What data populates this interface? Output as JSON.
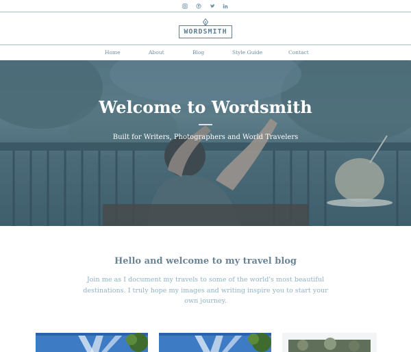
{
  "social": {
    "icons": [
      "instagram-icon",
      "pinterest-icon",
      "twitter-icon",
      "linkedin-icon"
    ]
  },
  "site": {
    "logo_text": "WORDSMITH"
  },
  "nav": {
    "items": [
      {
        "label": "Home"
      },
      {
        "label": "About"
      },
      {
        "label": "Blog"
      },
      {
        "label": "Style Guide"
      },
      {
        "label": "Contact"
      }
    ]
  },
  "hero": {
    "title": "Welcome to Wordsmith",
    "subtitle": "Built for Writers, Photographers and World Travelers"
  },
  "intro": {
    "title": "Hello and welcome to my travel blog",
    "text": "Join me as I document my travels to some of the world's most beautiful destinations. I truly hope my images and writing inspire you to start your own journey."
  },
  "colors": {
    "accent": "#6b8fa3",
    "border": "#9fbfd0",
    "hero_overlay": "#426880",
    "intro_text": "#8fb2c4"
  }
}
